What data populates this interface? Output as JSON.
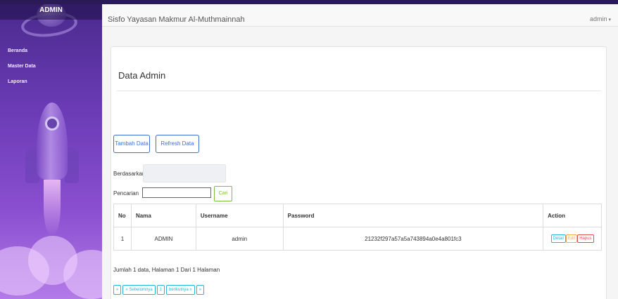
{
  "sidebar": {
    "brand": "ADMIN",
    "items": [
      {
        "label": "Beranda"
      },
      {
        "label": "Master Data"
      },
      {
        "label": "Laporan"
      }
    ]
  },
  "navbar": {
    "title": "Sisfo Yayasan Makmur Al-Muthmainnah",
    "user": "admin",
    "caret_icon": "caret-down-icon"
  },
  "page": {
    "title": "Data Admin",
    "buttons": {
      "add": "Tambah Data",
      "refresh": "Refresh Data"
    },
    "filter": {
      "based_label": "Berdasarkan:",
      "search_label": "Pencarian",
      "search_value": "",
      "search_button": "Cari"
    }
  },
  "table": {
    "headers": [
      "No",
      "Nama",
      "Username",
      "Password",
      "Action"
    ],
    "rows": [
      {
        "no": "1",
        "nama": "ADMIN",
        "username": "admin",
        "password": "21232f297a57a5a743894a0e4a801fc3",
        "actions": {
          "detail": "Detail",
          "edit": "Edit",
          "delete": "Hapus"
        }
      }
    ]
  },
  "footer": {
    "summary": "Jumlah 1 data, Halaman 1 Dari 1 Halaman",
    "pager": {
      "first": "«",
      "prev": "« Sebelumnya",
      "current": "1",
      "next": "berikutnya »",
      "last": "»"
    }
  },
  "colors": {
    "primary": "#3c6fd8",
    "success": "#7bc043",
    "info": "#29b6d8",
    "warning": "#f0ad4e",
    "danger": "#e05050",
    "sidebar": "#6a3bb5"
  }
}
